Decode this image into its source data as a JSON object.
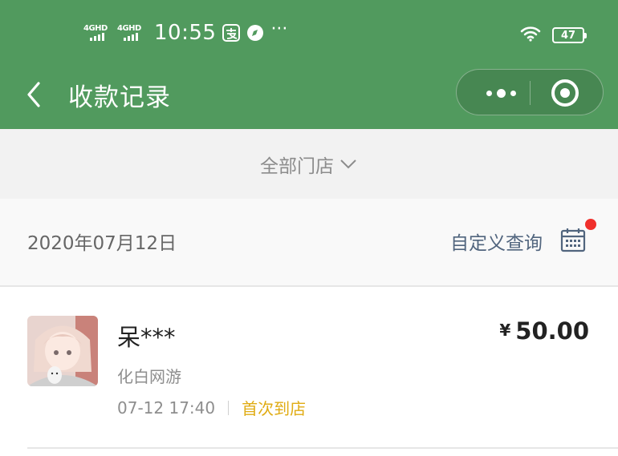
{
  "status_bar": {
    "signal_1_label": "4GHD",
    "signal_2_label": "4GHD",
    "time": "10:55",
    "more_indicator": "···",
    "battery_level": "47"
  },
  "navbar": {
    "title": "收款记录"
  },
  "store_filter": {
    "label": "全部门店"
  },
  "date_bar": {
    "date": "2020年07月12日",
    "custom_query_label": "自定义查询"
  },
  "records": [
    {
      "name": "呆***",
      "store": "化白网游",
      "currency": "¥",
      "amount": "50.00",
      "datetime": "07-12 17:40",
      "tag": "首次到店"
    }
  ],
  "colors": {
    "header_green": "#519a5e",
    "tag_yellow": "#e0ac14",
    "link_blue": "#51657e",
    "notification_red": "#f0302c"
  }
}
